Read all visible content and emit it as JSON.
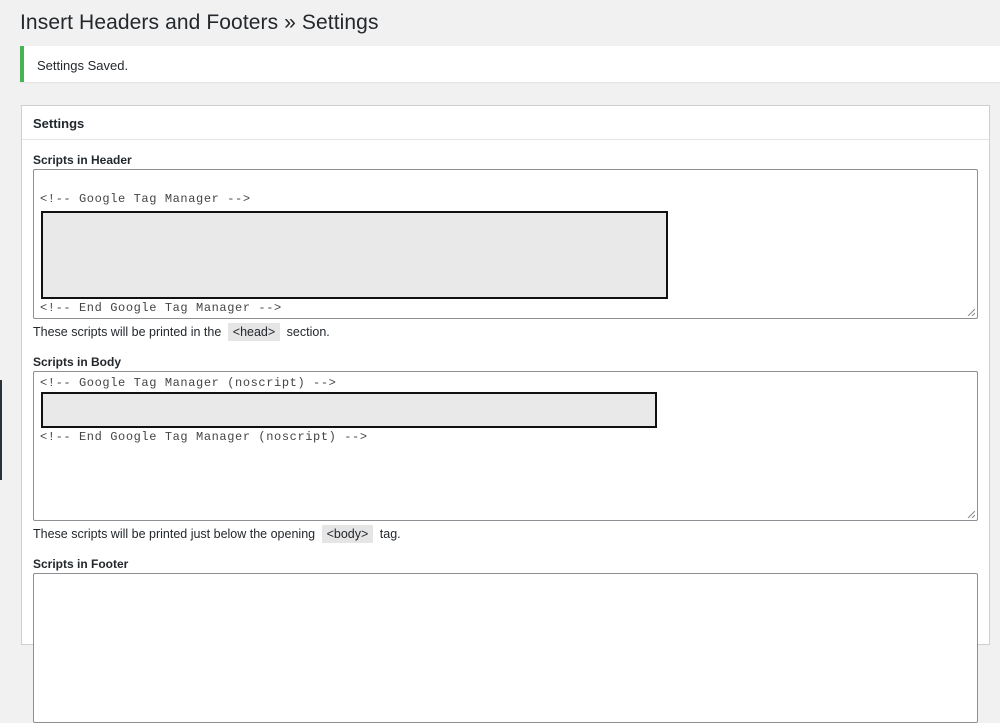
{
  "page": {
    "title": "Insert Headers and Footers » Settings"
  },
  "notice": {
    "text": "Settings Saved."
  },
  "panel": {
    "title": "Settings",
    "header_section": {
      "label": "Scripts in Header",
      "code_start": "<!-- Google Tag Manager -->",
      "code_end": "<!-- End Google Tag Manager -->",
      "desc_before": "These scripts will be printed in the",
      "desc_code": "<head>",
      "desc_after": "section."
    },
    "body_section": {
      "label": "Scripts in Body",
      "code_start": "<!-- Google Tag Manager (noscript) -->",
      "code_end": "<!-- End Google Tag Manager (noscript) -->",
      "desc_before": "These scripts will be printed just below the opening",
      "desc_code": "<body>",
      "desc_after": "tag."
    },
    "footer_section": {
      "label": "Scripts in Footer"
    }
  },
  "colors": {
    "notice_success": "#46b450",
    "redaction_fill": "#e9e9e9"
  }
}
